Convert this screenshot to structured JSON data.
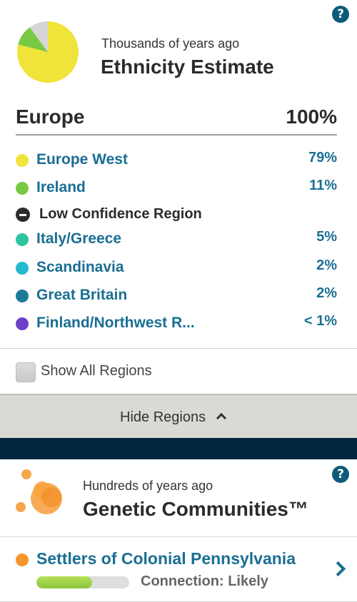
{
  "ethnicity": {
    "time_label": "Thousands of years ago",
    "title": "Ethnicity Estimate",
    "region": {
      "name": "Europe",
      "percent": "100%"
    },
    "items": [
      {
        "label": "Europe West",
        "percent": "79%",
        "color": "#f0e43a"
      },
      {
        "label": "Ireland",
        "percent": "11%",
        "color": "#7ac943"
      },
      {
        "label": "Low Confidence Region",
        "percent": "",
        "color": "#2b2b2b"
      },
      {
        "label": "Italy/Greece",
        "percent": "5%",
        "color": "#2ec4a0"
      },
      {
        "label": "Scandinavia",
        "percent": "2%",
        "color": "#26b8d0"
      },
      {
        "label": "Great Britain",
        "percent": "2%",
        "color": "#1c7a97"
      },
      {
        "label": "Finland/Northwest R...",
        "percent": "< 1%",
        "color": "#6b3fc9"
      }
    ],
    "pie_fractions": {
      "europe_west": 0.79,
      "ireland": 0.11,
      "other": 0.1
    },
    "show_all_label": "Show All Regions",
    "hide_regions_label": "Hide Regions"
  },
  "communities": {
    "time_label": "Hundreds of years ago",
    "title": "Genetic Communities™",
    "item": {
      "label": "Settlers of Colonial Pennsylvania",
      "connection": "Connection: Likely",
      "progress": 0.6,
      "color": "#f5962d"
    }
  },
  "colors": {
    "accent": "#1a6e93",
    "navy": "#032640",
    "help_icon": "#0e5b7a"
  },
  "icons": [
    "help-icon",
    "pie-chart-icon",
    "minus-circle-icon",
    "chevron-up-icon",
    "communities-icon",
    "chevron-right-icon"
  ]
}
